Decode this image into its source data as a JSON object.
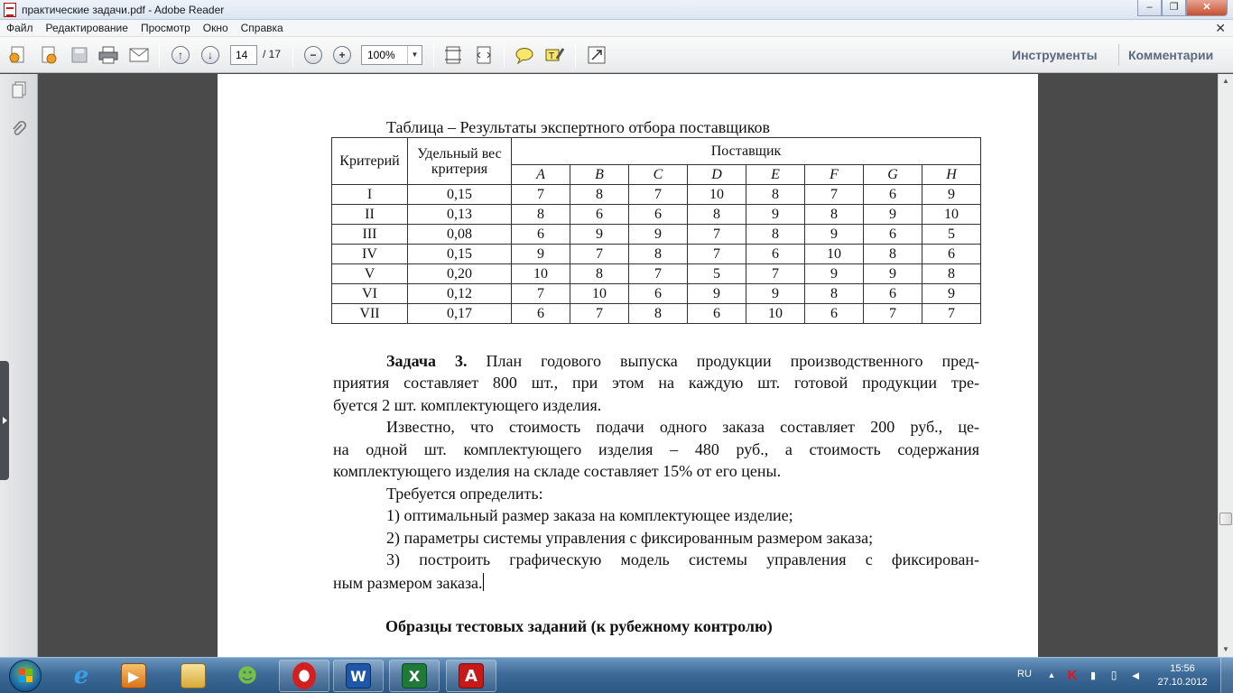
{
  "window": {
    "title": "практические задачи.pdf - Adobe Reader",
    "controls": [
      "–",
      "❐",
      "✕"
    ]
  },
  "menu": [
    "Файл",
    "Редактирование",
    "Просмотр",
    "Окно",
    "Справка"
  ],
  "toolbar": {
    "page_current": "14",
    "page_total": "/ 17",
    "zoom": "100%",
    "tools_label": "Инструменты",
    "comments_label": "Комментарии"
  },
  "document": {
    "table_caption": "Таблица – Результаты экспертного отбора поставщиков",
    "table": {
      "criterion_header": "Критерий",
      "weight_header_line1": "Удельный вес",
      "weight_header_line2": "критерия",
      "supplier_header": "Поставщик",
      "suppliers": [
        "A",
        "B",
        "C",
        "D",
        "E",
        "F",
        "G",
        "H"
      ],
      "rows": [
        {
          "c": "I",
          "w": "0,15",
          "v": [
            "7",
            "8",
            "7",
            "10",
            "8",
            "7",
            "6",
            "9"
          ]
        },
        {
          "c": "II",
          "w": "0,13",
          "v": [
            "8",
            "6",
            "6",
            "8",
            "9",
            "8",
            "9",
            "10"
          ]
        },
        {
          "c": "III",
          "w": "0,08",
          "v": [
            "6",
            "9",
            "9",
            "7",
            "8",
            "9",
            "6",
            "5"
          ]
        },
        {
          "c": "IV",
          "w": "0,15",
          "v": [
            "9",
            "7",
            "8",
            "7",
            "6",
            "10",
            "8",
            "6"
          ]
        },
        {
          "c": "V",
          "w": "0,20",
          "v": [
            "10",
            "8",
            "7",
            "5",
            "7",
            "9",
            "9",
            "8"
          ]
        },
        {
          "c": "VI",
          "w": "0,12",
          "v": [
            "7",
            "10",
            "6",
            "9",
            "9",
            "8",
            "6",
            "9"
          ]
        },
        {
          "c": "VII",
          "w": "0,17",
          "v": [
            "6",
            "7",
            "8",
            "6",
            "10",
            "6",
            "7",
            "7"
          ]
        }
      ]
    },
    "task3": {
      "label": "Задача 3.",
      "text": " План годового выпуска продукции производственного предприятия составляет 800 шт., при этом на каждую шт. готовой продукции требуется 2 шт. комплектующего изделия.",
      "para2": "Известно, что стоимость подачи одного заказа составляет 200 руб., цена одной шт. комплектующего изделия – 480 руб., а стоимость содержания комплектующего изделия на складе составляет 15% от его цены.",
      "req": "Требуется определить:",
      "item1": "1) оптимальный размер заказа на комплектующее изделие;",
      "item2": "2) параметры системы управления с фиксированным размером заказа;",
      "item3": "3) построить графическую модель системы управления с фиксированным размером заказа."
    },
    "heading": "Образцы тестовых заданий (к рубежному контролю)"
  },
  "taskbar": {
    "lang": "RU",
    "time": "15:56",
    "date": "27.10.2012"
  }
}
